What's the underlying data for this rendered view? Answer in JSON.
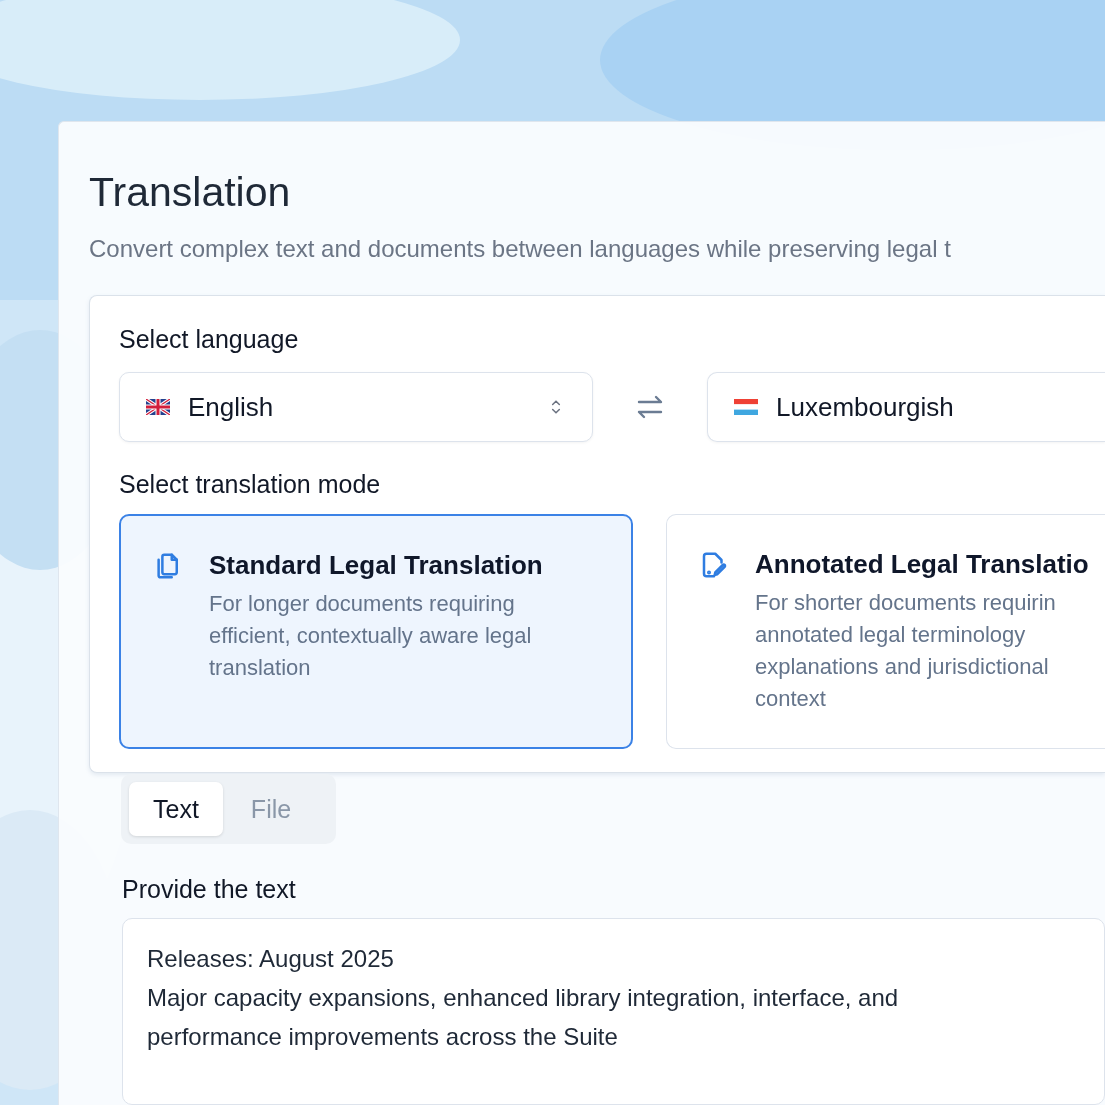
{
  "title": "Translation",
  "subtitle": "Convert complex text and documents between languages while preserving legal t",
  "language": {
    "label": "Select language",
    "source": {
      "value": "English"
    },
    "target": {
      "value": "Luxembourgish"
    }
  },
  "mode": {
    "label": "Select translation mode",
    "options": [
      {
        "title": "Standard Legal Translation",
        "description_lines": [
          "For longer documents requiring",
          "efficient, contextually aware legal",
          "translation"
        ],
        "selected": true
      },
      {
        "title": "Annotated Legal Translatio",
        "description_lines": [
          "For shorter documents requirin",
          "annotated legal terminology",
          "explanations and jurisdictional",
          "context"
        ],
        "selected": false
      }
    ]
  },
  "input_tabs": [
    {
      "label": "Text",
      "selected": true
    },
    {
      "label": "File",
      "selected": false
    }
  ],
  "text_input": {
    "label": "Provide the text",
    "value_lines": [
      "Releases: August 2025",
      "Major capacity expansions, enhanced library integration, interface, and",
      "performance improvements across the Suite"
    ]
  }
}
